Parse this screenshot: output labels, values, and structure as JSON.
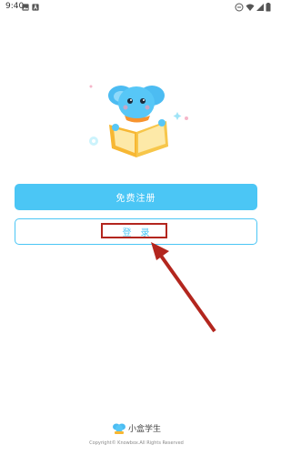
{
  "status_bar": {
    "time": "9:40",
    "left_icons": [
      "image-icon",
      "a-icon"
    ],
    "right_icons": [
      "minus-circle-icon",
      "wifi-icon",
      "signal-icon",
      "battery-icon"
    ]
  },
  "illustration": {
    "name": "elephant-reading-book-mascot"
  },
  "buttons": {
    "register_label": "免费注册",
    "login_label": "登录"
  },
  "footer": {
    "brand": "小盒学生",
    "copyright": "Copyright© Knowbox.All Rights Reserved"
  },
  "colors": {
    "accent": "#4bc6f5",
    "annotation": "#b3261e"
  }
}
